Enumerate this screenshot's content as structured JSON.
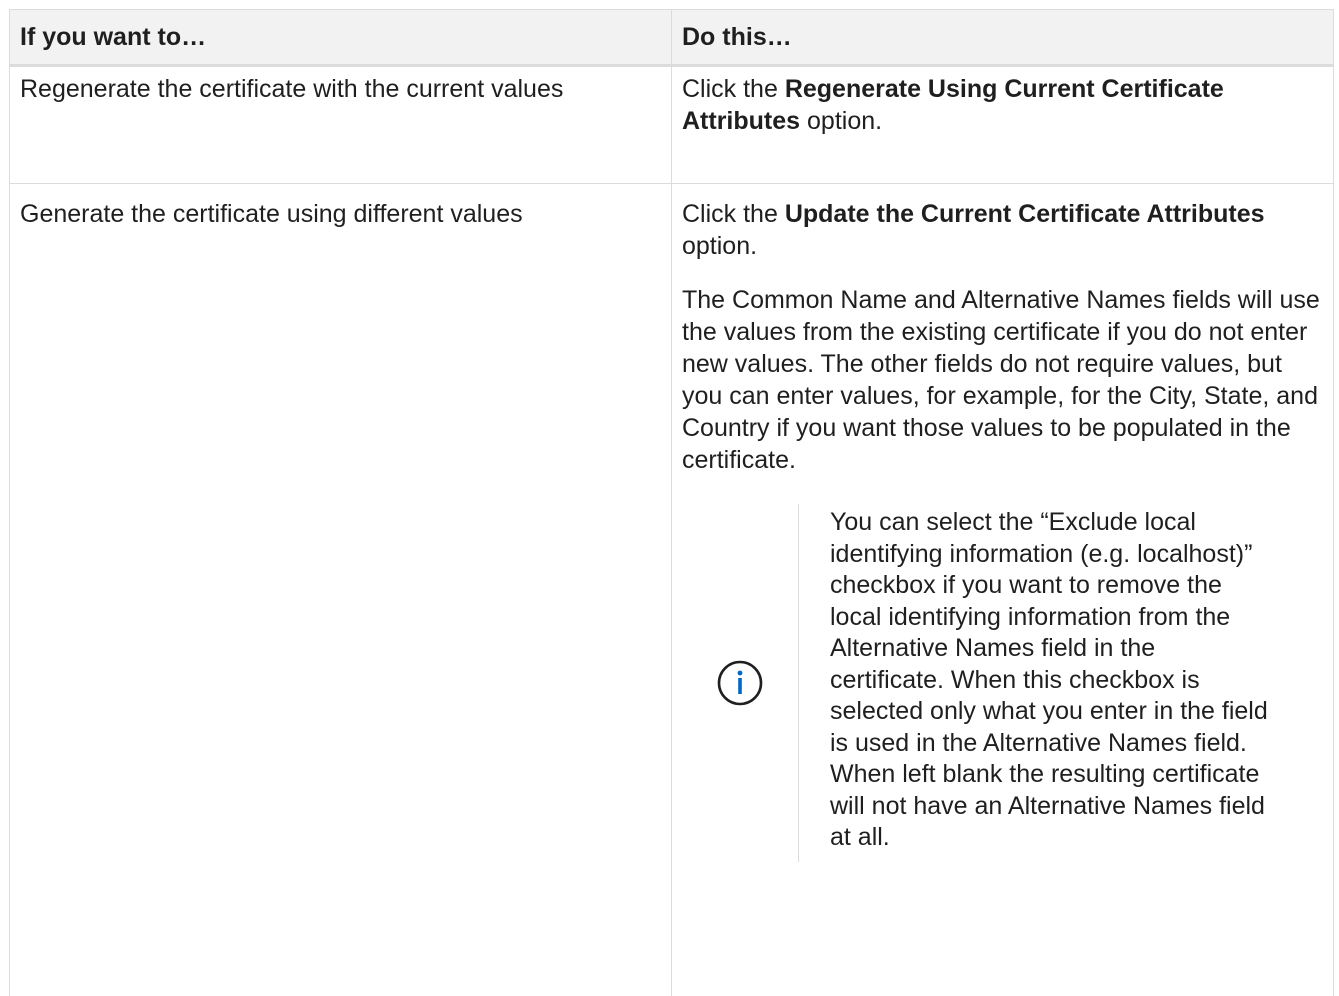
{
  "table": {
    "header": {
      "col1": "If you want to…",
      "col2": "Do this…"
    },
    "rows": [
      {
        "want": "Regenerate the certificate with the current values",
        "action_prefix": "Click the ",
        "action_bold": "Regenerate Using Current Certificate Attributes",
        "action_suffix": " option."
      },
      {
        "want": "Generate the certificate using different values",
        "action_prefix": "Click the ",
        "action_bold": "Update the Current Certificate Attributes",
        "action_suffix": " option.",
        "detail": "The Common Name and Alternative Names fields will use the values from the existing certificate if you do not enter new values. The other fields do not require values, but you can enter values, for example, for the City, State, and Country if you want those values to be populated in the certificate.",
        "note": {
          "icon": "info-icon",
          "text": "You can select the “Exclude local identifying information (e.g. localhost)” checkbox if you want to remove the local identifying information from the Alternative Names field in the certificate. When this checkbox is selected only what you enter in the field is used in the Alternative Names field. When left blank the resulting certificate will not have an Alternative Names field at all."
        }
      }
    ]
  },
  "colors": {
    "accent": "#0067c5",
    "border": "#dcdcdc",
    "header_bg": "#f2f2f2"
  }
}
